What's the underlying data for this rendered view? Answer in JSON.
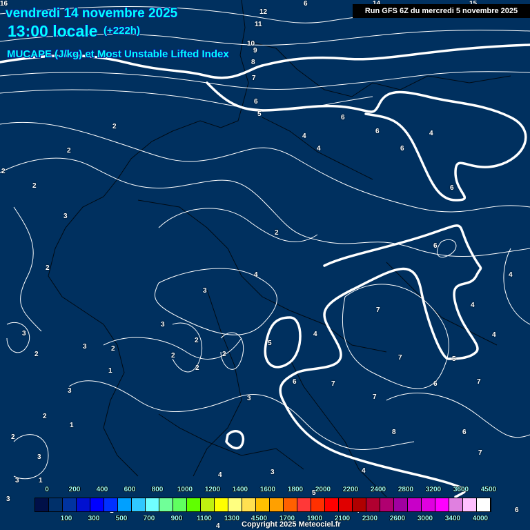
{
  "header": {
    "date": "vendredi 14 novembre 2025",
    "hour": "13:00 locale",
    "lead": "(+222h)",
    "title": "MUCAPE (J/kg) et Most Unstable Lifted Index",
    "run": "Run GFS 6Z du mercredi 5 novembre 2025"
  },
  "contour_labels": [
    "12",
    "11",
    "10",
    "9",
    "8",
    "7",
    "6",
    "5",
    "6",
    "4",
    "4",
    "6",
    "6",
    "4",
    "6",
    "6",
    "2",
    "2",
    "2",
    "3",
    "2",
    "2",
    "2",
    "3",
    "4",
    "4",
    "3",
    "3",
    "3",
    "2",
    "2",
    "2",
    "2",
    "2",
    "1",
    "3",
    "2",
    "1",
    "2",
    "2",
    "3",
    "3",
    "3",
    "1",
    "5",
    "4",
    "6",
    "7",
    "7",
    "7",
    "7",
    "7",
    "6",
    "6",
    "5",
    "4",
    "4",
    "4",
    "7",
    "8",
    "6",
    "7",
    "5",
    "4",
    "4",
    "3",
    "3",
    "6",
    "6",
    "1",
    "4",
    "6",
    "14",
    "15",
    "16"
  ],
  "colorbar": {
    "colors": [
      "#001048",
      "#00306a",
      "#0033a0",
      "#0010d0",
      "#0000ff",
      "#0030ff",
      "#00a0ff",
      "#30c8ff",
      "#70ffff",
      "#70ff98",
      "#60ff60",
      "#60ff00",
      "#c0f010",
      "#ffff00",
      "#ffff80",
      "#ffe050",
      "#ffc000",
      "#ffa000",
      "#ff6000",
      "#ff3838",
      "#ff3000",
      "#ff0000",
      "#e00000",
      "#b00000",
      "#b00030",
      "#b00070",
      "#a000a0",
      "#c800c8",
      "#e000e0",
      "#ff00ff",
      "#e080e0",
      "#ffc0ff",
      "#ffffff"
    ],
    "top_labels": [
      "0",
      "200",
      "400",
      "600",
      "800",
      "1000",
      "1200",
      "1400",
      "1600",
      "1800",
      "2000",
      "2200",
      "2400",
      "2800",
      "3200",
      "3600",
      "4500"
    ],
    "bottom_labels": [
      "100",
      "300",
      "500",
      "700",
      "900",
      "1100",
      "1300",
      "1500",
      "1700",
      "1900",
      "2100",
      "2300",
      "2600",
      "3000",
      "3400",
      "4000"
    ]
  },
  "copyright": "Copyright 2025 Meteociel.fr"
}
